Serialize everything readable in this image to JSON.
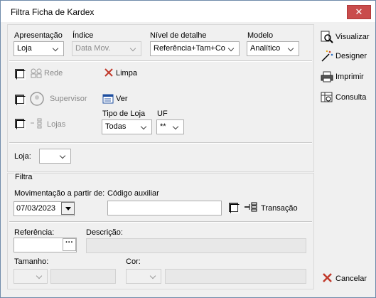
{
  "window": {
    "title": "Filtra Ficha de Kardex",
    "close_glyph": "✕"
  },
  "top_filters": {
    "apresentacao": {
      "label": "Apresentação",
      "value": "Loja"
    },
    "indice": {
      "label": "Índice",
      "value": "Data Mov."
    },
    "nivel": {
      "label": "Nível de detalhe",
      "value": "Referência+Tam+Co"
    },
    "modelo": {
      "label": "Modelo",
      "value": "Analítico"
    }
  },
  "options": {
    "rede": "Rede",
    "supervisor": "Supervisor",
    "lojas": "Lojas",
    "limpa": "Limpa",
    "ver": "Ver",
    "tipo_loja": {
      "label": "Tipo de Loja",
      "value": "Todas"
    },
    "uf": {
      "label": "UF",
      "value": "**"
    },
    "loja_label": "Loja:"
  },
  "filtra": {
    "title": "Filtra",
    "movimentacao_label": "Movimentação a partir de:",
    "movimentacao_value": "07/03/2023",
    "codigo_label": "Código auxiliar",
    "codigo_value": "",
    "transacao_label": "Transação",
    "referencia_label": "Referência:",
    "referencia_button": "···",
    "descricao_label": "Descrição:",
    "tamanho_label": "Tamanho:",
    "cor_label": "Cor:"
  },
  "side_buttons": {
    "visualizar": "Visualizar",
    "designer": "Designer",
    "imprimir": "Imprimir",
    "consulta": "Consulta",
    "cancelar": "Cancelar"
  },
  "colors": {
    "accent_red": "#c0392b",
    "title_bar_close": "#c94c4c"
  }
}
